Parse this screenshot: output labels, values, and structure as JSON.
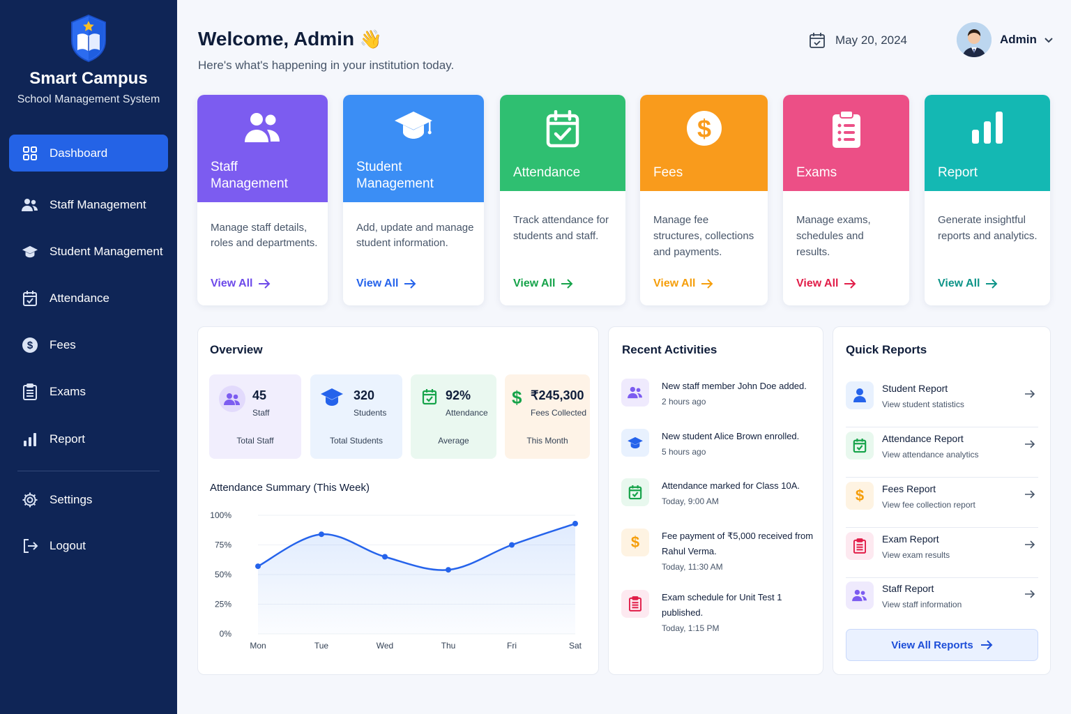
{
  "brand": {
    "title": "Smart Campus",
    "subtitle": "School Management System"
  },
  "nav": {
    "items": [
      {
        "label": "Dashboard",
        "icon": "grid-icon",
        "active": true
      },
      {
        "label": "Staff Management",
        "icon": "users-icon"
      },
      {
        "label": "Student Management",
        "icon": "graduation-cap-icon"
      },
      {
        "label": "Attendance",
        "icon": "calendar-check-icon"
      },
      {
        "label": "Fees",
        "icon": "dollar-icon"
      },
      {
        "label": "Exams",
        "icon": "clipboard-icon"
      },
      {
        "label": "Report",
        "icon": "bar-chart-icon"
      },
      {
        "label": "Settings",
        "icon": "gear-icon"
      },
      {
        "label": "Logout",
        "icon": "logout-icon"
      }
    ]
  },
  "header": {
    "welcome": "Welcome, Admin",
    "subtitle": "Here's what's happening in your institution today.",
    "date": "May 20, 2024",
    "user": "Admin"
  },
  "modules": [
    {
      "title": "Staff\nManagement",
      "desc": "Manage staff details, roles and departments.",
      "link": "View All",
      "color": "#7c5cf0"
    },
    {
      "title": "Student\nManagement",
      "desc": "Add, update and manage student information.",
      "link": "View All",
      "color": "#3b8ef5"
    },
    {
      "title": "Attendance",
      "desc": "Track attendance for students and staff.",
      "link": "View All",
      "color": "#2fbf71"
    },
    {
      "title": "Fees",
      "desc": "Manage fee structures, collections and payments.",
      "link": "View All",
      "color": "#f99b1c"
    },
    {
      "title": "Exams",
      "desc": "Manage exams, schedules and results.",
      "link": "View All",
      "color": "#ec4f86"
    },
    {
      "title": "Report",
      "desc": "Generate insightful reports and analytics.",
      "link": "View All",
      "color": "#14b8b3"
    }
  ],
  "overview": {
    "title": "Overview",
    "stats": [
      {
        "value": "45",
        "label": "Staff",
        "caption": "Total Staff"
      },
      {
        "value": "320",
        "label": "Students",
        "caption": "Total Students"
      },
      {
        "value": "92%",
        "label": "Attendance",
        "caption": "Average"
      },
      {
        "value": "₹245,300",
        "label": "Fees Collected",
        "caption": "This Month"
      }
    ],
    "chart_title": "Attendance Summary (This Week)"
  },
  "chart_data": {
    "type": "line",
    "categories": [
      "Mon",
      "Tue",
      "Wed",
      "Thu",
      "Fri",
      "Sat"
    ],
    "values": [
      57,
      84,
      65,
      54,
      75,
      93
    ],
    "ylim": [
      0,
      100
    ],
    "yticks": [
      "0%",
      "25%",
      "50%",
      "75%",
      "100%"
    ],
    "grid": true,
    "color": "#2563eb"
  },
  "activities": {
    "title": "Recent Activities",
    "items": [
      {
        "text": "New staff member John Doe added.",
        "time": "2 hours ago"
      },
      {
        "text": "New student Alice Brown enrolled.",
        "time": "5 hours ago"
      },
      {
        "text": "Attendance marked for Class 10A.",
        "time": "Today, 9:00 AM"
      },
      {
        "text": "Fee payment of ₹5,000 received from Rahul Verma.",
        "time": "Today, 11:30 AM"
      },
      {
        "text": "Exam schedule for Unit Test 1 published.",
        "time": "Today, 1:15 PM"
      }
    ]
  },
  "quick_reports": {
    "title": "Quick Reports",
    "items": [
      {
        "title": "Student Report",
        "sub": "View student statistics"
      },
      {
        "title": "Attendance Report",
        "sub": "View attendance analytics"
      },
      {
        "title": "Fees Report",
        "sub": "View fee collection report"
      },
      {
        "title": "Exam Report",
        "sub": "View exam results"
      },
      {
        "title": "Staff Report",
        "sub": "View staff information"
      }
    ],
    "button": "View All Reports"
  }
}
